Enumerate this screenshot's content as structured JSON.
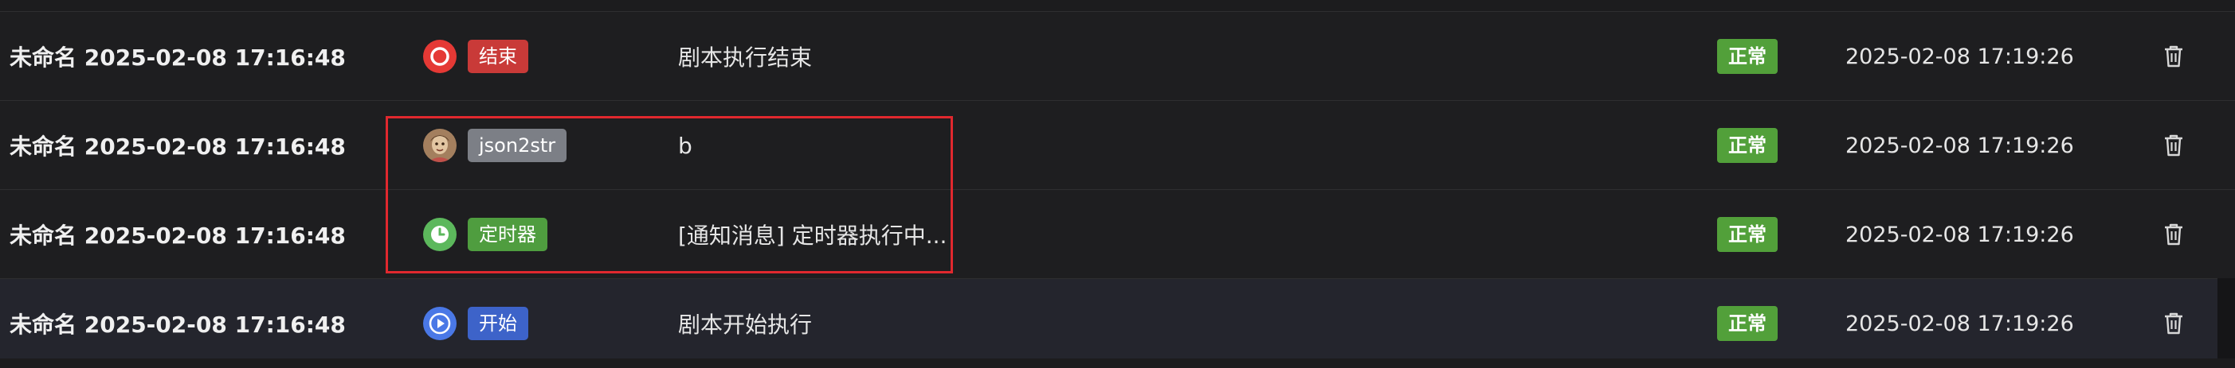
{
  "rows": [
    {
      "name": "未命名 2025-02-08 17:16:48",
      "node_icon": "stop-circle-icon",
      "node_label": "结束",
      "node_color": "#c93a38",
      "icon_color": "#e53935",
      "message": "剧本执行结束",
      "status": "正常",
      "time": "2025-02-08 17:19:26",
      "delete_icon": "trash-icon"
    },
    {
      "name": "未命名 2025-02-08 17:16:48",
      "node_icon": "avatar-icon",
      "node_label": "json2str",
      "node_color": "#7c7f86",
      "icon_color": "#b08a6a",
      "message": "b",
      "status": "正常",
      "time": "2025-02-08 17:19:26",
      "delete_icon": "trash-icon"
    },
    {
      "name": "未命名 2025-02-08 17:16:48",
      "node_icon": "clock-icon",
      "node_label": "定时器",
      "node_color": "#4f9d3f",
      "icon_color": "#5cb85c",
      "message": "[通知消息] 定时器执行中...",
      "status": "正常",
      "time": "2025-02-08 17:19:26",
      "delete_icon": "trash-icon"
    },
    {
      "name": "未命名 2025-02-08 17:16:48",
      "node_icon": "play-circle-icon",
      "node_label": "开始",
      "node_color": "#3d63c9",
      "icon_color": "#4a78e6",
      "message": "剧本开始执行",
      "status": "正常",
      "time": "2025-02-08 17:19:26",
      "delete_icon": "trash-icon"
    }
  ],
  "colors": {
    "background": "#1c1c1e",
    "row_hover": "#24252d",
    "status_ok": "#52a03a",
    "highlight_border": "#e0282e"
  }
}
